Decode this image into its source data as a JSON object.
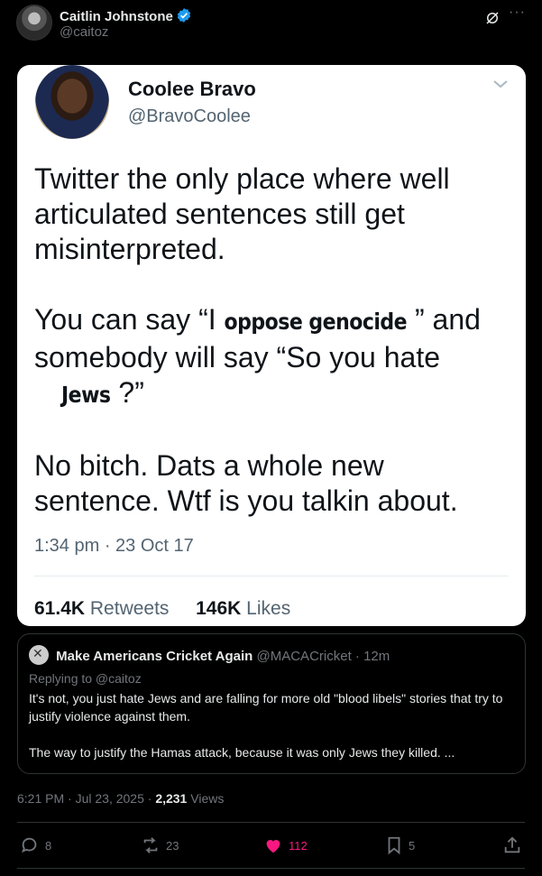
{
  "post": {
    "author_name": "Caitlin Johnstone",
    "author_handle": "@caitoz",
    "more_glyph": "···"
  },
  "embedded_tweet": {
    "name": "Coolee Bravo",
    "handle": "@BravoCoolee",
    "line1": "Twitter the only place where well articulated sentences still get misinterpreted.",
    "line2_a": "You can say “I ",
    "line2_redact1": "oppose genocide",
    "line2_b": " ” and somebody will say “So you hate",
    "line2_redact2": "Jews",
    "line2_c": " ?”",
    "line3": "No bitch. Dats a whole new sentence. Wtf is you talkin about.",
    "time": "1:34 pm · 23 Oct 17",
    "retweets_count": "61.4K",
    "retweets_label": "Retweets",
    "likes_count": "146K",
    "likes_label": "Likes"
  },
  "quote": {
    "name": "Make Americans Cricket Again",
    "handle": "@MACACricket",
    "age": "· 12m",
    "replying_to": "Replying to @caitoz",
    "para1": "It's not, you just hate Jews and are falling for more old \"blood libels\" stories that try to justify violence against them.",
    "para2": "The way to justify the Hamas attack, because it was only Jews they killed. ..."
  },
  "meta": {
    "time_date": "6:21 PM · Jul 23, 2025 · ",
    "views_count": "2,231",
    "views_label": " Views"
  },
  "actions": {
    "replies": "8",
    "reposts": "23",
    "likes": "112",
    "bookmarks": "5"
  },
  "colors": {
    "background": "#000000",
    "text_primary": "#e7e9ea",
    "text_secondary": "#71767b",
    "verified": "#1d9bf0",
    "like": "#f91880",
    "border": "#2f3336"
  },
  "icons": [
    "verified-badge-icon",
    "grok-icon",
    "more-icon",
    "chevron-down-icon",
    "reply-icon",
    "repost-icon",
    "heart-icon",
    "bookmark-icon",
    "share-icon"
  ]
}
